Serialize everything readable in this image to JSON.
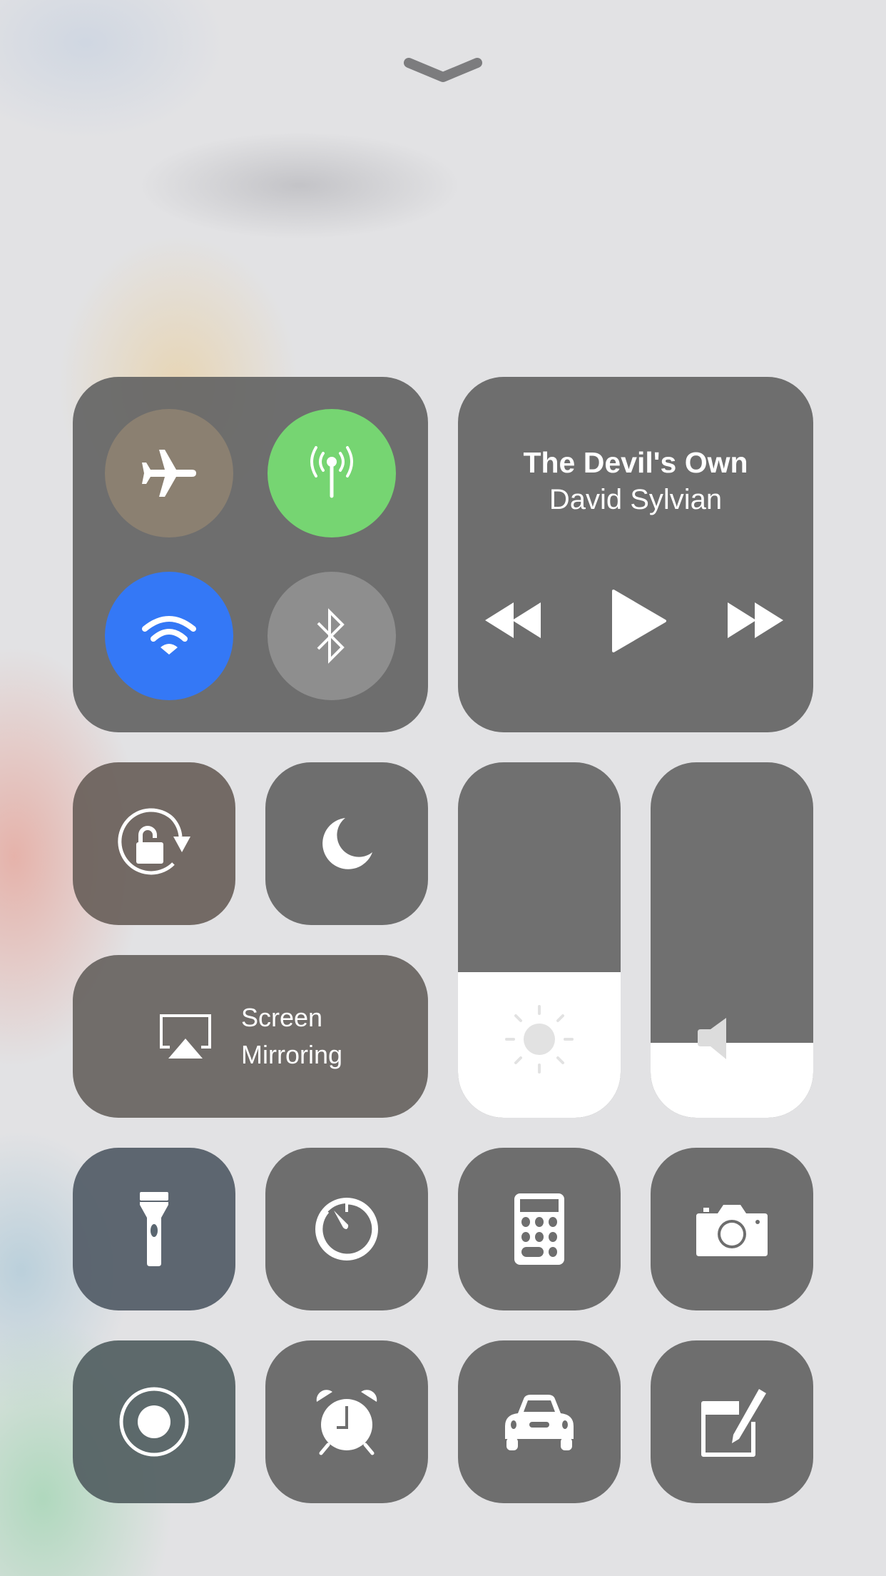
{
  "control_center": {
    "dismiss_handle": {
      "icon": "chevron-down-icon"
    },
    "connectivity": {
      "airplane": {
        "icon": "airplane-icon",
        "state": "off",
        "color": "#8a7f72"
      },
      "cellular": {
        "icon": "cellular-antenna-icon",
        "state": "on",
        "color": "#76d572"
      },
      "wifi": {
        "icon": "wifi-icon",
        "state": "on",
        "color": "#3478f6"
      },
      "bluetooth": {
        "icon": "bluetooth-icon",
        "state": "off",
        "color": "#8e8e8e"
      }
    },
    "now_playing": {
      "title": "The Devil's Own",
      "artist": "David Sylvian",
      "controls": [
        "rewind",
        "play",
        "fast-forward"
      ]
    },
    "toggles": {
      "orientation_lock": {
        "icon": "rotation-lock-icon"
      },
      "do_not_disturb": {
        "icon": "moon-icon"
      }
    },
    "screen_mirroring": {
      "line1": "Screen",
      "line2": "Mirroring",
      "icon": "airplay-icon"
    },
    "brightness": {
      "level_percent": 41,
      "icon": "sun-icon"
    },
    "volume": {
      "level_percent": 21,
      "icon": "speaker-icon"
    },
    "shortcuts": [
      {
        "name": "flashlight",
        "icon": "flashlight-icon"
      },
      {
        "name": "timer",
        "icon": "timer-icon"
      },
      {
        "name": "calculator",
        "icon": "calculator-icon"
      },
      {
        "name": "camera",
        "icon": "camera-icon"
      },
      {
        "name": "screen-recording",
        "icon": "record-icon"
      },
      {
        "name": "alarm",
        "icon": "alarm-clock-icon"
      },
      {
        "name": "do-not-disturb-while-driving",
        "icon": "car-icon"
      },
      {
        "name": "notes",
        "icon": "notes-icon"
      }
    ]
  }
}
